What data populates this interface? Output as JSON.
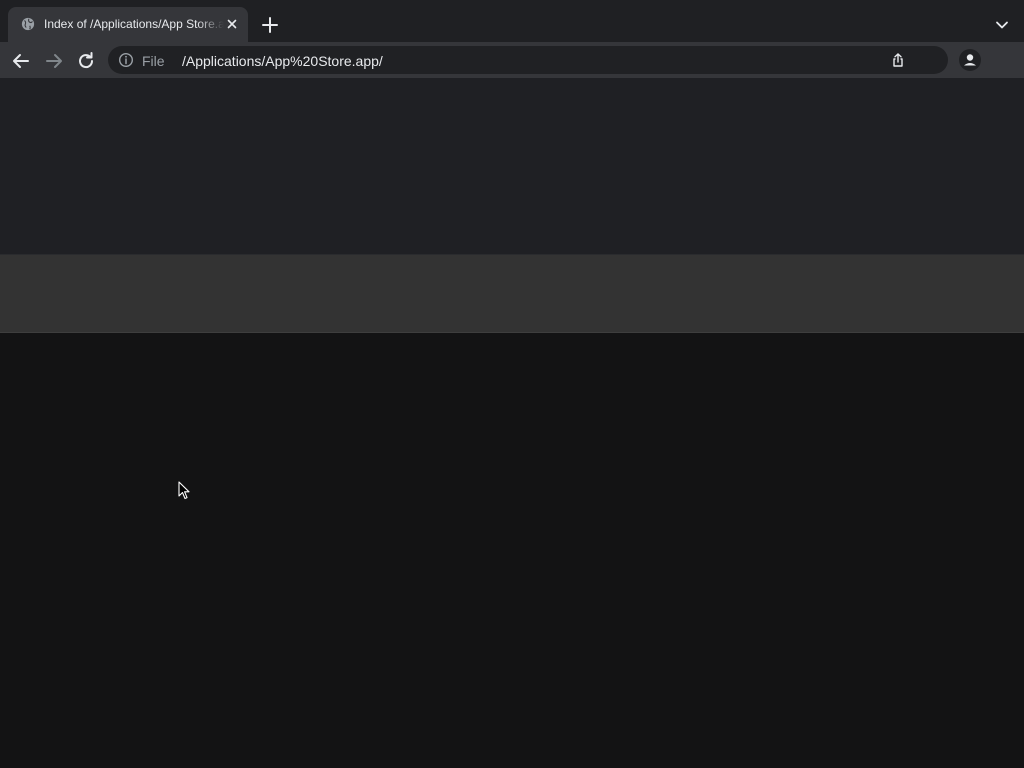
{
  "tab": {
    "title": "Index of /Applications/App Store.app/",
    "favicon": "globe-icon"
  },
  "toolbar": {
    "scheme_label": "File",
    "url": "/Applications/App%20Store.app/"
  },
  "icons": {
    "back": "back-arrow-icon",
    "forward": "forward-arrow-icon",
    "reload": "reload-icon",
    "info": "info-icon",
    "share": "share-icon",
    "profile": "profile-icon",
    "new_tab": "plus-icon",
    "tab_search": "chevron-down-icon",
    "close": "close-icon"
  },
  "colors": {
    "tabstrip": "#1f2023",
    "toolbar": "#35363a",
    "omnibox": "#202124",
    "page_background": "#131314"
  }
}
